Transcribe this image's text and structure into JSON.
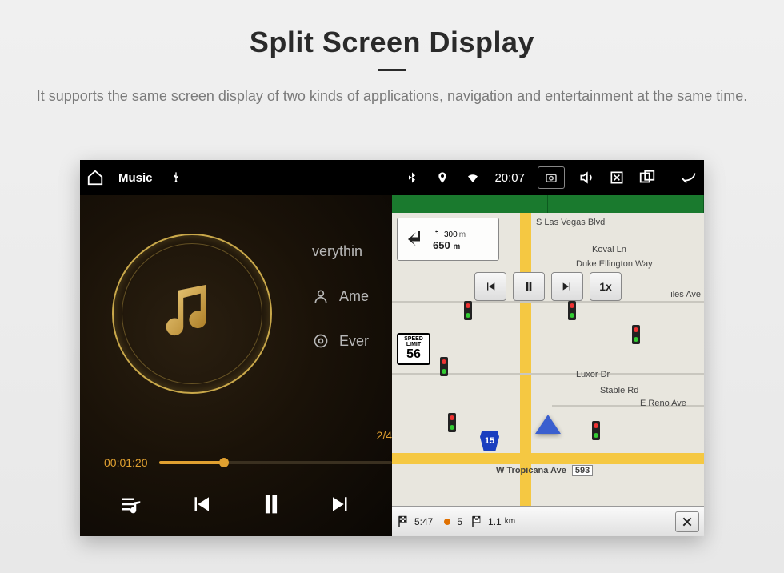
{
  "header": {
    "title": "Split Screen Display",
    "description": "It supports the same screen display of two kinds of applications, navigation and entertainment at the same time."
  },
  "statusbar": {
    "app_label": "Music",
    "time": "20:07"
  },
  "music": {
    "tracks": {
      "row1": "verythin",
      "row2": "Ame",
      "row3": "Ever"
    },
    "page": "2/4",
    "elapsed": "00:01:20"
  },
  "nav": {
    "street_top": "S Las Vegas Blvd",
    "street_koval": "Koval Ln",
    "street_duke": "Duke Ellington Way",
    "street_luxor": "Luxor Dr",
    "street_stable": "Stable Rd",
    "street_reno": "E Reno Ave",
    "street_bottom": "W Tropicana Ave",
    "street_bottom_num": "593",
    "street_iles": "iles Ave",
    "turn": {
      "primary_dist": "650",
      "primary_unit": "m",
      "secondary_dist": "300",
      "secondary_unit": "m"
    },
    "speed": {
      "label_top": "SPEED",
      "label_mid": "LIMIT",
      "value": "56"
    },
    "media_speed": "1x",
    "route_shield": "15",
    "bottom": {
      "eta": "5:47",
      "dist": "1.1",
      "dist_unit": "km",
      "stops": "5"
    }
  }
}
